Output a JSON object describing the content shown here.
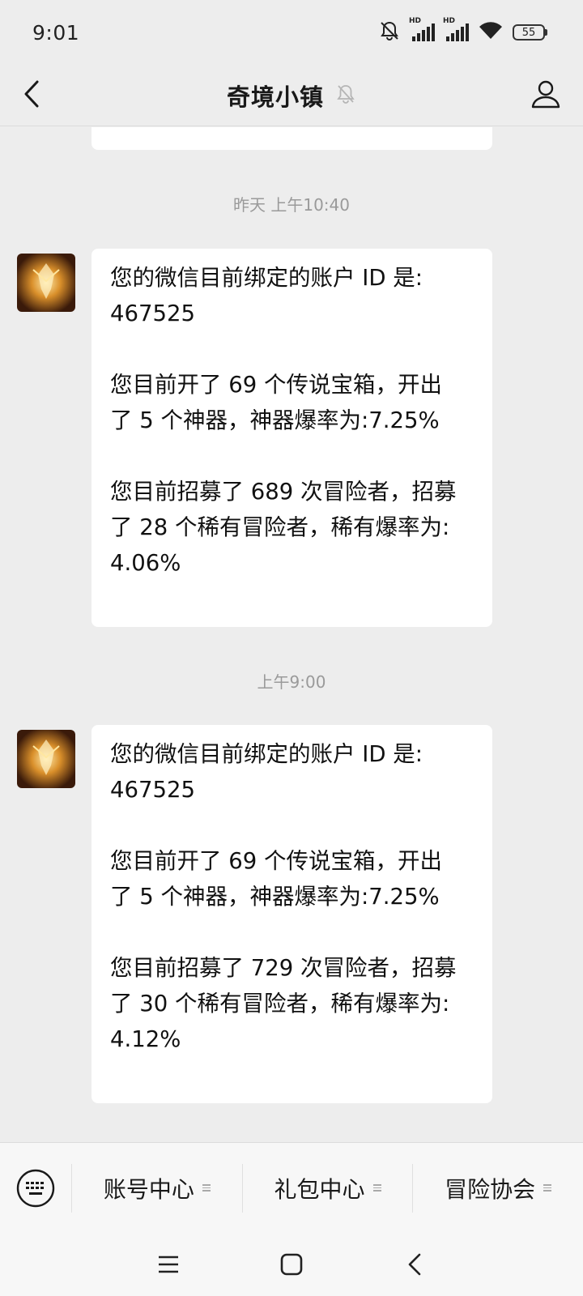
{
  "status_bar": {
    "time": "9:01",
    "signal_label": "HD",
    "battery": "55",
    "icons": [
      "mute-icon",
      "signal-icon",
      "signal-icon",
      "wifi-icon",
      "battery-icon"
    ]
  },
  "header": {
    "title": "奇境小镇",
    "back_icon": "chevron-left-icon",
    "mute_icon": "bell-off-icon",
    "profile_icon": "person-icon"
  },
  "messages": [
    {
      "timestamp": "昨天 上午10:40",
      "text": "您的微信目前绑定的账户 ID 是:\n467525\n\n您目前开了 69 个传说宝箱，开出\n了 5 个神器，神器爆率为:7.25%\n\n您目前招募了 689 次冒险者，招募\n了 28 个稀有冒险者，稀有爆率为:\n4.06%"
    },
    {
      "timestamp": "上午9:00",
      "text": "您的微信目前绑定的账户 ID 是:\n467525\n\n您目前开了 69 个传说宝箱，开出\n了 5 个神器，神器爆率为:7.25%\n\n您目前招募了 729 次冒险者，招募\n了 30 个稀有冒险者，稀有爆率为:\n4.12%"
    }
  ],
  "bottom_menu": {
    "keyboard_icon": "keyboard-icon",
    "items": [
      {
        "label": "账号中心"
      },
      {
        "label": "礼包中心"
      },
      {
        "label": "冒险协会"
      }
    ]
  },
  "system_nav": {
    "icons": [
      "menu-icon",
      "home-icon",
      "back-icon"
    ]
  }
}
